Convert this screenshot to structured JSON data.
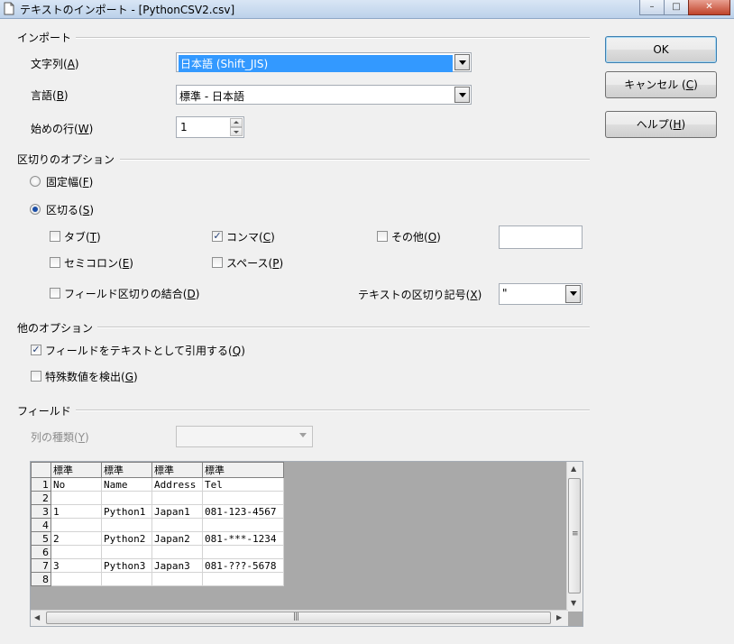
{
  "window": {
    "title": "テキストのインポート - [PythonCSV2.csv]",
    "min_label": "–",
    "max_label": "□",
    "close_label": "✕"
  },
  "buttons": {
    "ok": "OK",
    "ok_key": "O",
    "cancel": "キャンセル (",
    "cancel_key": "C",
    "cancel_tail": ")",
    "help": "ヘルプ(",
    "help_key": "H",
    "help_tail": ")"
  },
  "import": {
    "heading": "インポート",
    "charset_label": "文字列(",
    "charset_key": "A",
    "charset_value": "日本語 (Shift_JIS)",
    "language_label": "言語(",
    "language_key": "B",
    "language_value": "標準 - 日本語",
    "startrow_label": "始めの行(",
    "startrow_key": "W",
    "startrow_value": "1"
  },
  "separator": {
    "heading": "区切りのオプション",
    "fixed_label": "固定幅(",
    "fixed_key": "F",
    "separated_label": "区切る(",
    "separated_key": "S",
    "tab_label": "タブ(",
    "tab_key": "T",
    "comma_label": "コンマ(",
    "comma_key": "C",
    "other_label": "その他(",
    "other_key": "O",
    "semicolon_label": "セミコロン(",
    "semicolon_key": "E",
    "space_label": "スペース(",
    "space_key": "P",
    "merge_label": "フィールド区切りの結合(",
    "merge_key": "D",
    "textdelim_label": "テキストの区切り記号(",
    "textdelim_key": "X",
    "textdelim_value": "\"",
    "checked_mark": "✓"
  },
  "other": {
    "heading": "他のオプション",
    "quoted_label": "フィールドをテキストとして引用する(",
    "quoted_key": "Q",
    "detect_label": "特殊数値を検出(",
    "detect_key": "G"
  },
  "fields": {
    "heading": "フィールド",
    "coltype_label": "列の種類(",
    "coltype_key": "Y",
    "columns": [
      "標準",
      "標準",
      "標準",
      "標準"
    ],
    "rows": [
      [
        "1",
        "No",
        "Name",
        "Address",
        "Tel"
      ],
      [
        "2",
        "",
        "",
        "",
        ""
      ],
      [
        "3",
        "1",
        "Python1",
        "Japan1",
        "081-123-4567"
      ],
      [
        "4",
        "",
        "",
        "",
        ""
      ],
      [
        "5",
        "2",
        "Python2",
        "Japan2",
        "081-***-1234"
      ],
      [
        "6",
        "",
        "",
        "",
        ""
      ],
      [
        "7",
        "3",
        "Python3",
        "Japan3",
        "081-???-5678"
      ],
      [
        "8",
        "",
        "",
        "",
        ""
      ]
    ]
  }
}
